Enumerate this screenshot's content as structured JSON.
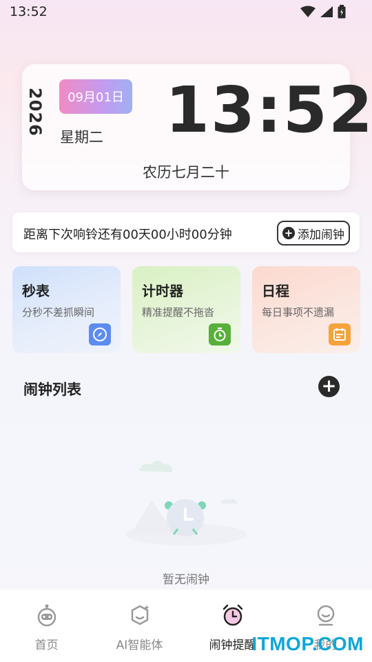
{
  "status_bar": {
    "time": "13:52"
  },
  "clock_card": {
    "year": "2026",
    "date": "09月01日",
    "weekday": "星期二",
    "time": "13:52",
    "lunar": "农历七月二十"
  },
  "next_alarm": {
    "text": "距离下次响铃还有00天00小时00分钟",
    "add_button": "添加闹钟"
  },
  "features": [
    {
      "title": "秒表",
      "subtitle": "分秒不差抓瞬间",
      "icon": "compass-icon",
      "color": "#5b8cf0"
    },
    {
      "title": "计时器",
      "subtitle": "精准提醒不拖沓",
      "icon": "timer-icon",
      "color": "#58b03a"
    },
    {
      "title": "日程",
      "subtitle": "每日事项不遗漏",
      "icon": "calendar-icon",
      "color": "#f5a33a"
    }
  ],
  "alarm_list": {
    "title": "闹钟列表",
    "empty_text": "暂无闹钟"
  },
  "nav": {
    "items": [
      {
        "label": "首页",
        "icon": "robot-icon",
        "active": false
      },
      {
        "label": "AI智能体",
        "icon": "ai-agent-icon",
        "active": false
      },
      {
        "label": "闹钟提醒",
        "icon": "alarm-clock-icon",
        "active": true
      },
      {
        "label": "我的",
        "icon": "profile-icon",
        "active": false
      }
    ]
  },
  "watermark": "ITMOP.COM"
}
